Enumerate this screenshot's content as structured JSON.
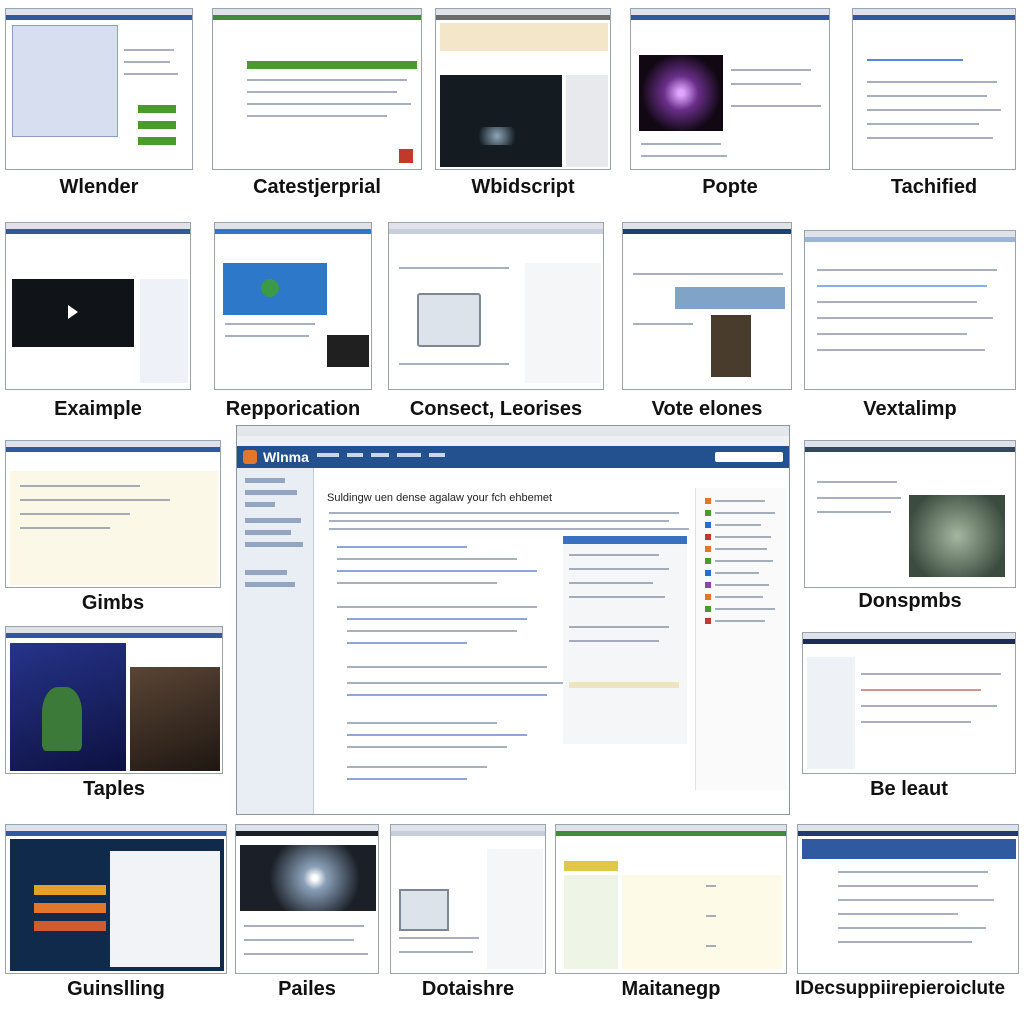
{
  "captions": {
    "c1": "Wlender",
    "c2": "Catestjerprial",
    "c3": "Wbidscript",
    "c4": "Popte",
    "c5": "Tachified",
    "c6": "Exaimple",
    "c7": "Repporication",
    "c8": "Consect, Leorises",
    "c9": "Vote elones",
    "c10": "Vextalimp",
    "c11": "Gimbs",
    "c12": "Donspmbs",
    "c13": "Taples",
    "c14": "Be leaut",
    "c15": "Guinslling",
    "c16": "Pailes",
    "c17": "Dotaishre",
    "c18": "Maitanegp",
    "c19": "IDecsuppiirepieroiclute"
  },
  "center": {
    "logo_text": "Wlnma",
    "heading": "Suldingw uen dense agalaw your fch ehbemet"
  },
  "colors": {
    "nav_blue": "#23518f",
    "accent_orange": "#e2762a",
    "accent_green": "#4a9a2e"
  }
}
